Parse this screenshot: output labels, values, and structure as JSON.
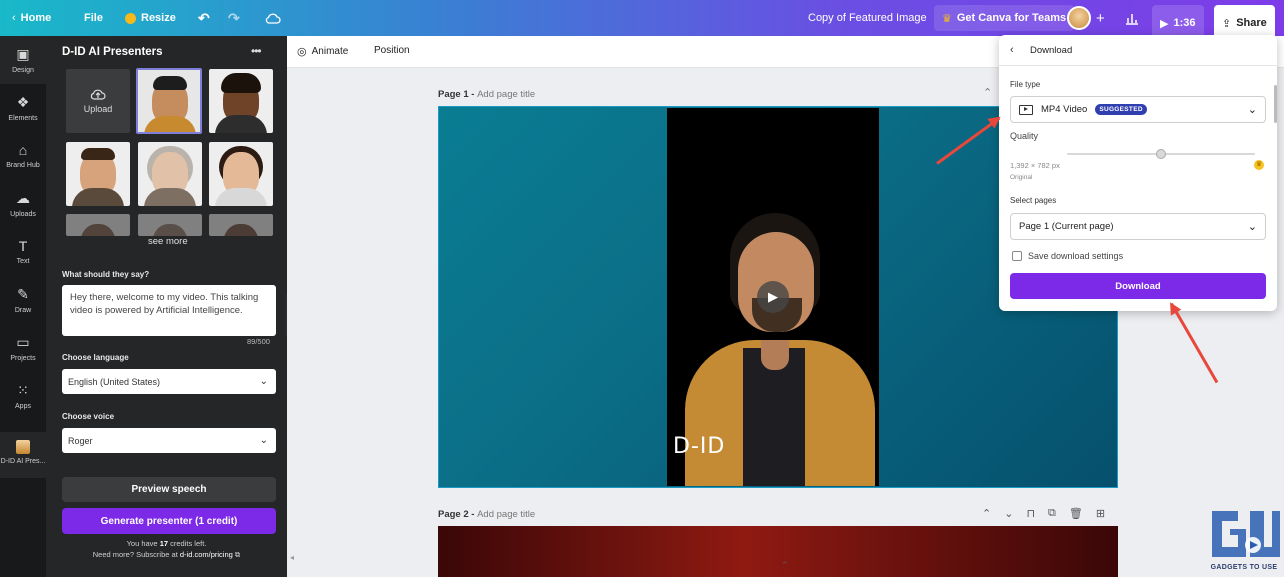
{
  "topbar": {
    "home": "Home",
    "file": "File",
    "resize": "Resize",
    "doc_title": "Copy of Featured Image",
    "teams": "Get Canva for Teams",
    "add": "+",
    "play_time": "1:36",
    "share": "Share"
  },
  "rail": [
    {
      "label": "Design",
      "icon": "design-icon"
    },
    {
      "label": "Elements",
      "icon": "elements-icon"
    },
    {
      "label": "Brand Hub",
      "icon": "brand-hub-icon"
    },
    {
      "label": "Uploads",
      "icon": "upload-icon"
    },
    {
      "label": "Text",
      "icon": "text-icon"
    },
    {
      "label": "Draw",
      "icon": "draw-icon"
    },
    {
      "label": "Projects",
      "icon": "folder-icon"
    },
    {
      "label": "Apps",
      "icon": "apps-icon"
    },
    {
      "label": "D-ID AI Pres..."
    }
  ],
  "panel": {
    "title": "D-ID AI Presenters",
    "more": "•••",
    "upload": "Upload",
    "see_more": "see more",
    "say_label": "What should they say?",
    "script_text": "Hey there, welcome to my video. This talking video is powered by Artificial Intelligence.",
    "char_count": "89/500",
    "language_label": "Choose language",
    "language_value": "English (United States)",
    "voice_label": "Choose voice",
    "voice_value": "Roger",
    "preview": "Preview speech",
    "generate": "Generate presenter (1 credit)",
    "credits_prefix": "You have ",
    "credits_count": "17",
    "credits_suffix": " credits left.",
    "subscribe_prefix": "Need more? Subscribe at ",
    "subscribe_link": "d-id.com/pricing"
  },
  "editor": {
    "animate": "Animate",
    "position": "Position",
    "page1_label": "Page 1 - ",
    "page1_placeholder": "Add page title",
    "page2_label": "Page 2 - ",
    "page2_placeholder": "Add page title",
    "video_logo": "D-ID"
  },
  "download": {
    "title": "Download",
    "file_type_label": "File type",
    "file_type_value": "MP4 Video",
    "suggested": "SUGGESTED",
    "quality_label": "Quality",
    "quality_fraction": 0.5,
    "dimensions": "1,392 × 782 px",
    "original": "Original",
    "select_pages_label": "Select pages",
    "pages_value": "Page 1 (Current page)",
    "save_settings": "Save download settings",
    "download_button": "Download"
  },
  "watermark": {
    "text": "GADGETS TO USE"
  },
  "colors": {
    "accent": "#7d2ae8",
    "annotation": "#e8473b",
    "badge": "#2f3fb0"
  }
}
